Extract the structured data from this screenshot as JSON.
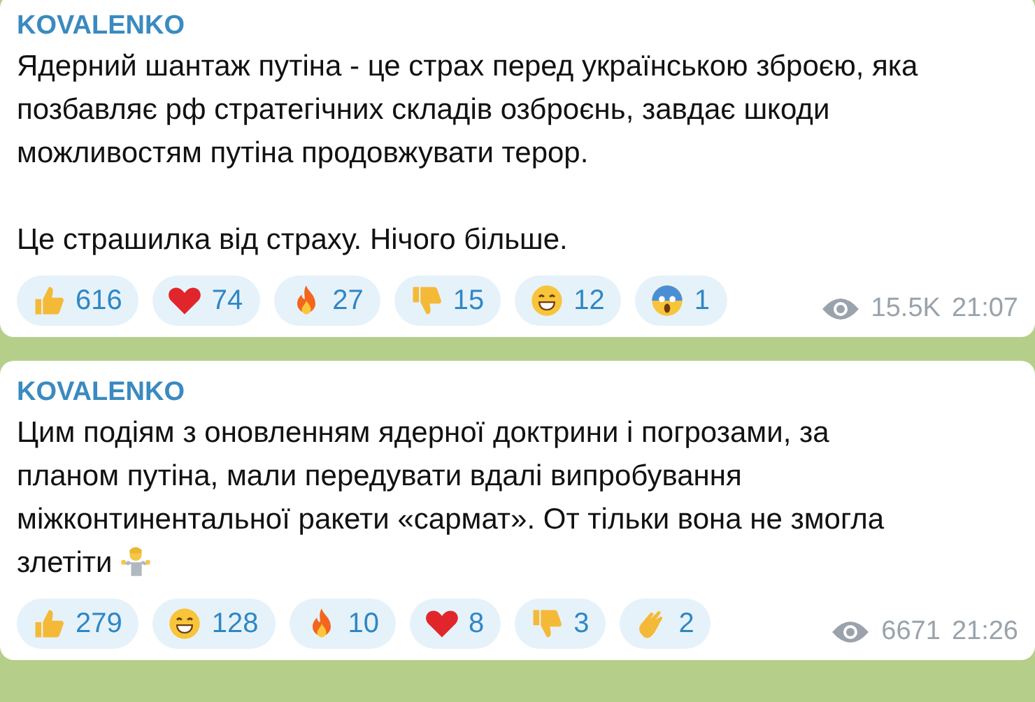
{
  "messages": [
    {
      "author": "KOVALENKO",
      "paragraphs": [
        "Ядерний шантаж путіна - це страх перед українською зброєю, яка позбавляє рф стратегічних складів озброєнь, завдає шкоди можливостям путіна продовжувати терор.",
        "Це страшилка від страху. Нічого більше."
      ],
      "reactions": [
        {
          "kind": "thumbs_up",
          "count": "616"
        },
        {
          "kind": "heart",
          "count": "74"
        },
        {
          "kind": "fire",
          "count": "27"
        },
        {
          "kind": "thumbs_down",
          "count": "15"
        },
        {
          "kind": "grin",
          "count": "12"
        },
        {
          "kind": "scream",
          "count": "1"
        }
      ],
      "views": "15.5K",
      "time": "21:07"
    },
    {
      "author": "KOVALENKO",
      "paragraphs": [
        "Цим подіям з оновленням ядерної доктрини і погрозами, за планом путіна, мали передувати вдалі випробування міжконтинентальної ракети «сармат». От тільки вона не змогла злетіти"
      ],
      "inline_icons": [
        {
          "kind": "shrug"
        }
      ],
      "reactions": [
        {
          "kind": "thumbs_up",
          "count": "279"
        },
        {
          "kind": "grin",
          "count": "128"
        },
        {
          "kind": "fire",
          "count": "10"
        },
        {
          "kind": "heart",
          "count": "8"
        },
        {
          "kind": "thumbs_down",
          "count": "3"
        },
        {
          "kind": "clap",
          "count": "2"
        }
      ],
      "views": "6671",
      "time": "21:26"
    }
  ]
}
